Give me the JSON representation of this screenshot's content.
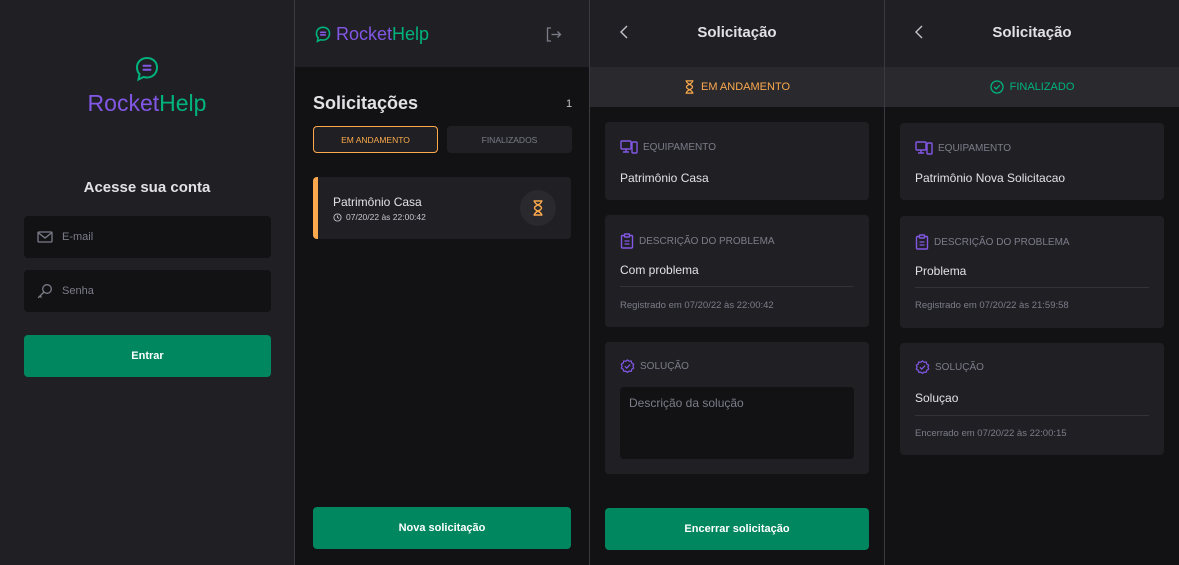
{
  "login": {
    "brand_part1": "Rocket",
    "brand_part2": "Help",
    "title": "Acesse sua conta",
    "email_placeholder": "E-mail",
    "password_placeholder": "Senha",
    "submit_label": "Entrar"
  },
  "list": {
    "brand_part1": "Rocket",
    "brand_part2": "Help",
    "title": "Solicitações",
    "count": "1",
    "filters": [
      {
        "label": "EM ANDAMENTO",
        "active": true
      },
      {
        "label": "FINALIZADOS",
        "active": false
      }
    ],
    "orders": [
      {
        "title": "Patrimônio Casa",
        "date": "07/20/22 às 22:00:42",
        "status_icon": "hourglass-icon"
      }
    ],
    "new_button_label": "Nova solicitação"
  },
  "detail_open": {
    "title": "Solicitação",
    "status": "EM ANDAMENTO",
    "status_color": "#FBA94C",
    "equipment_label": "EQUIPAMENTO",
    "equipment_value": "Patrimônio Casa",
    "description_label": "DESCRIÇÃO DO PROBLEMA",
    "description_value": "Com problema",
    "registered": "Registrado em 07/20/22 às 22:00:42",
    "solution_label": "SOLUÇÃO",
    "solution_placeholder": "Descrição da solução",
    "close_button_label": "Encerrar solicitação"
  },
  "detail_closed": {
    "title": "Solicitação",
    "status": "FINALIZADO",
    "status_color": "#00B37E",
    "equipment_label": "EQUIPAMENTO",
    "equipment_value": "Patrimônio Nova Solicitacao",
    "description_label": "DESCRIÇÃO DO PROBLEMA",
    "description_value": "Problema",
    "registered": "Registrado em 07/20/22 às 21:59:58",
    "solution_label": "SOLUÇÃO",
    "solution_value": "Soluçao",
    "closed": "Encerrado em 07/20/22 às 22:00:15"
  },
  "colors": {
    "brand_purple": "#8257E5",
    "brand_green": "#00B37E",
    "button_green": "#00875F",
    "accent_orange": "#FBA94C"
  }
}
